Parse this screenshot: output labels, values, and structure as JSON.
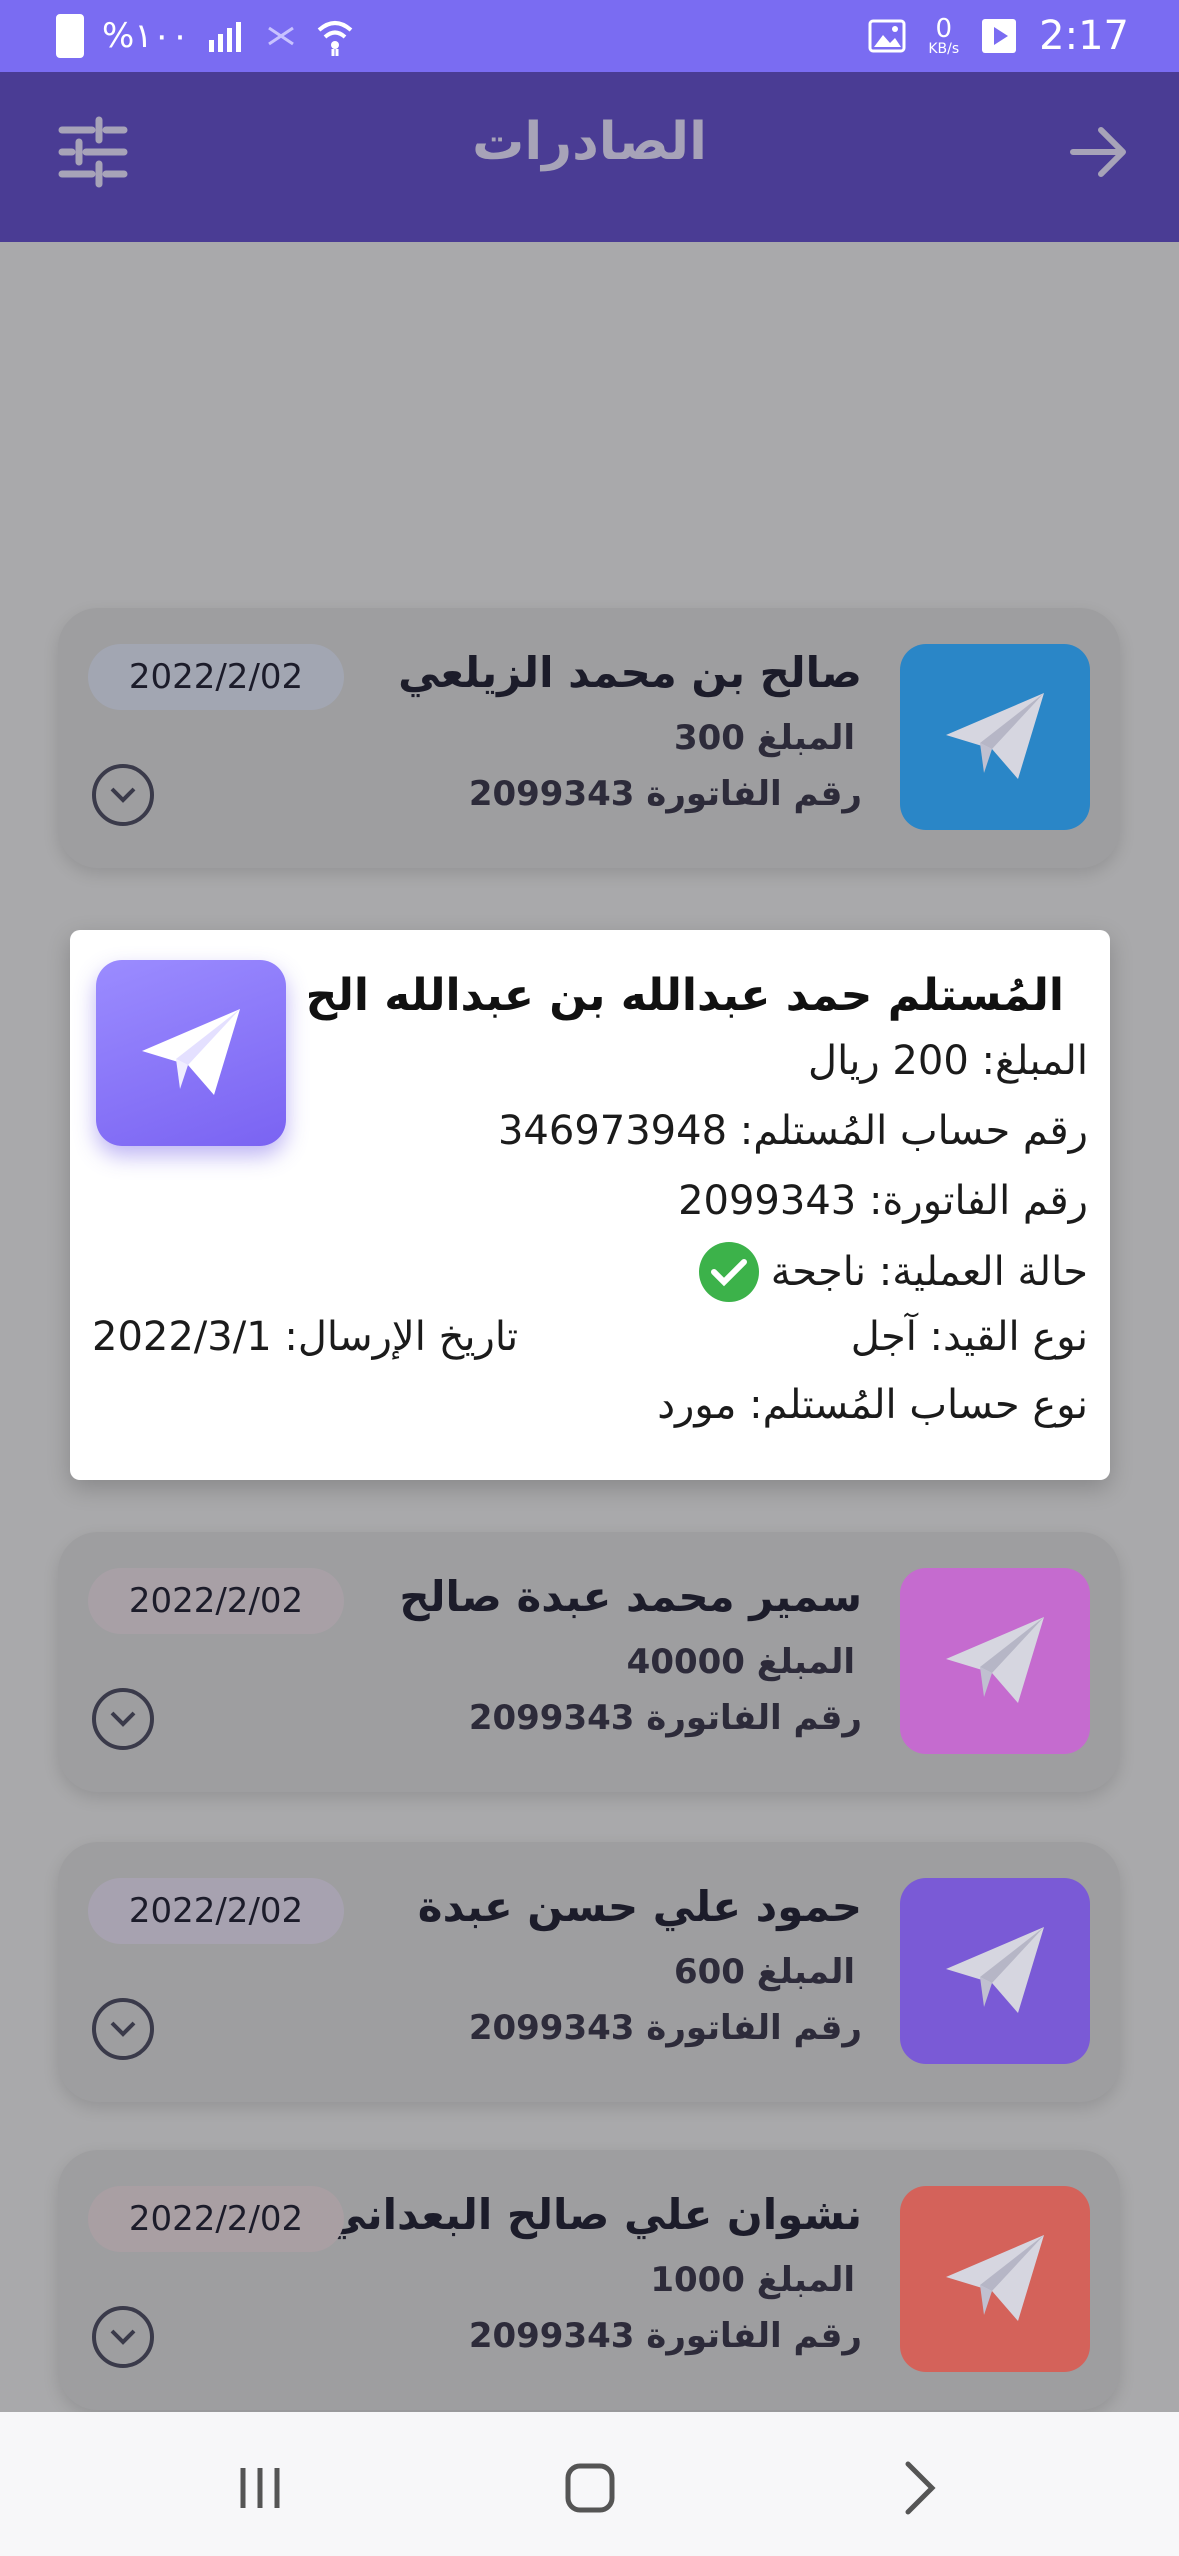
{
  "status": {
    "battery": "%١٠٠",
    "time": "2:17",
    "speed_value": "0",
    "speed_unit": "KB/s"
  },
  "header": {
    "title": "الصادرات",
    "back_icon": "arrow-right-icon",
    "filter_icon": "sliders-icon"
  },
  "cards": [
    {
      "name": "صالح بن محمد الزيلعي",
      "amount": "المبلغ 300",
      "invoice": "رقم الفاتورة 2099343",
      "date": "2022/2/02",
      "thumb_color": "#2a86c7",
      "date_bg": "#a2a6b2"
    },
    {
      "name": "سمير محمد عبدة صالح",
      "amount": "المبلغ 40000",
      "invoice": "رقم الفاتورة 2099343",
      "date": "2022/2/02",
      "thumb_color": "#c56bcf",
      "date_bg": "#a8a0a6"
    },
    {
      "name": "حمود علي حسن عبدة",
      "amount": "المبلغ 600",
      "invoice": "رقم الفاتورة 2099343",
      "date": "2022/2/02",
      "thumb_color": "#7a5ad6",
      "date_bg": "#a7a2b0"
    },
    {
      "name": "نشوان علي صالح البعداني",
      "amount": "المبلغ 1000",
      "invoice": "رقم الفاتورة 2099343",
      "date": "2022/2/02",
      "thumb_color": "#d4625a",
      "date_bg": "#a99fa3"
    }
  ],
  "popup": {
    "receiver": "المُستلم حمد عبدالله بن عبدالله الح...",
    "amount": "المبلغ: 200 ريال",
    "receiver_account": "رقم حساب المُستلم: 346973948",
    "invoice": "رقم الفاتورة: 2099343",
    "status": "حالة العملية: ناجحة",
    "entry_type": "نوع القيد: آجل",
    "send_date": "تاريخ الإرسال: 2022/3/1",
    "account_type": "نوع حساب المُستلم: مورد"
  },
  "nav": {
    "recent_icon": "recent-apps-icon",
    "home_icon": "home-icon",
    "back_icon": "back-chevron-icon"
  }
}
